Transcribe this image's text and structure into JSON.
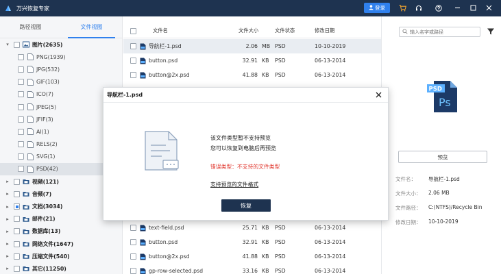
{
  "app": {
    "title": "万兴恢复专家",
    "login_label": "登录"
  },
  "sidebar": {
    "tabs": [
      {
        "label": "路径视图"
      },
      {
        "label": "文件视图"
      }
    ],
    "tree": [
      {
        "label": "图片(2635)",
        "level": 0,
        "chevron": "▾",
        "bold": true
      },
      {
        "label": "PNG(1939)",
        "level": 1
      },
      {
        "label": "JPG(532)",
        "level": 1
      },
      {
        "label": "GIF(103)",
        "level": 1
      },
      {
        "label": "ICO(7)",
        "level": 1
      },
      {
        "label": "JPEG(5)",
        "level": 1
      },
      {
        "label": "JFIF(3)",
        "level": 1
      },
      {
        "label": "AI(1)",
        "level": 1
      },
      {
        "label": "RELS(2)",
        "level": 1
      },
      {
        "label": "SVG(1)",
        "level": 1
      },
      {
        "label": "PSD(42)",
        "level": 1,
        "selected": true
      },
      {
        "label": "视频(121)",
        "level": 0,
        "chevron": "▸",
        "bold": true
      },
      {
        "label": "音频(7)",
        "level": 0,
        "chevron": "▸",
        "bold": true
      },
      {
        "label": "文档(3034)",
        "level": 0,
        "chevron": "▸",
        "bold": true,
        "partial": true
      },
      {
        "label": "邮件(21)",
        "level": 0,
        "chevron": "▸",
        "bold": true
      },
      {
        "label": "数据库(13)",
        "level": 0,
        "chevron": "▸",
        "bold": true
      },
      {
        "label": "网络文件(1647)",
        "level": 0,
        "chevron": "▸",
        "bold": true
      },
      {
        "label": "压缩文件(540)",
        "level": 0,
        "chevron": "▸",
        "bold": true
      },
      {
        "label": "其它(11250)",
        "level": 0,
        "chevron": "▸",
        "bold": true
      }
    ]
  },
  "filelist": {
    "headers": {
      "name": "文件名",
      "size": "文件大小",
      "status": "文件状态",
      "modified": "修改日期"
    },
    "rows": [
      {
        "name": "导航栏-1.psd",
        "size": "2.06",
        "unit": "MB",
        "type": "PSD",
        "date": "10-10-2019",
        "selected": true
      },
      {
        "name": "button.psd",
        "size": "32.91",
        "unit": "KB",
        "type": "PSD",
        "date": "06-13-2014"
      },
      {
        "name": "button@2x.psd",
        "size": "41.88",
        "unit": "KB",
        "type": "PSD",
        "date": "06-13-2014"
      }
    ],
    "rows_bottom": [
      {
        "name": "text-field.psd",
        "size": "25.71",
        "unit": "KB",
        "type": "PSD",
        "date": "06-13-2014"
      },
      {
        "name": "button.psd",
        "size": "32.91",
        "unit": "KB",
        "type": "PSD",
        "date": "06-13-2014"
      },
      {
        "name": "button@2x.psd",
        "size": "41.88",
        "unit": "KB",
        "type": "PSD",
        "date": "06-13-2014"
      },
      {
        "name": "gp-row-selected.psd",
        "size": "33.16",
        "unit": "KB",
        "type": "PSD",
        "date": "06-13-2014"
      }
    ]
  },
  "preview": {
    "search_placeholder": "输入名字或路径",
    "preview_button": "预览",
    "info": [
      {
        "key": "文件名：",
        "value": "导航栏-1.psd"
      },
      {
        "key": "文件大小：",
        "value": "2.06  MB"
      },
      {
        "key": "文件路径：",
        "value": "C:(NTFS)/Recycle Bin"
      },
      {
        "key": "修改日期：",
        "value": "10-10-2019"
      }
    ]
  },
  "dialog": {
    "title": "导航栏-1.psd",
    "message_line1": "该文件类型暂不支持预览",
    "message_line2": "您可以恢复到电脑后再预览",
    "error": "错误类型：不支持的文件类型",
    "link": "支持预览的文件格式",
    "recover_button": "恢复"
  },
  "colors": {
    "titlebar": "#1e3350",
    "accent": "#2f80ed",
    "error": "#e0342b",
    "psd": "#1c3a67"
  }
}
